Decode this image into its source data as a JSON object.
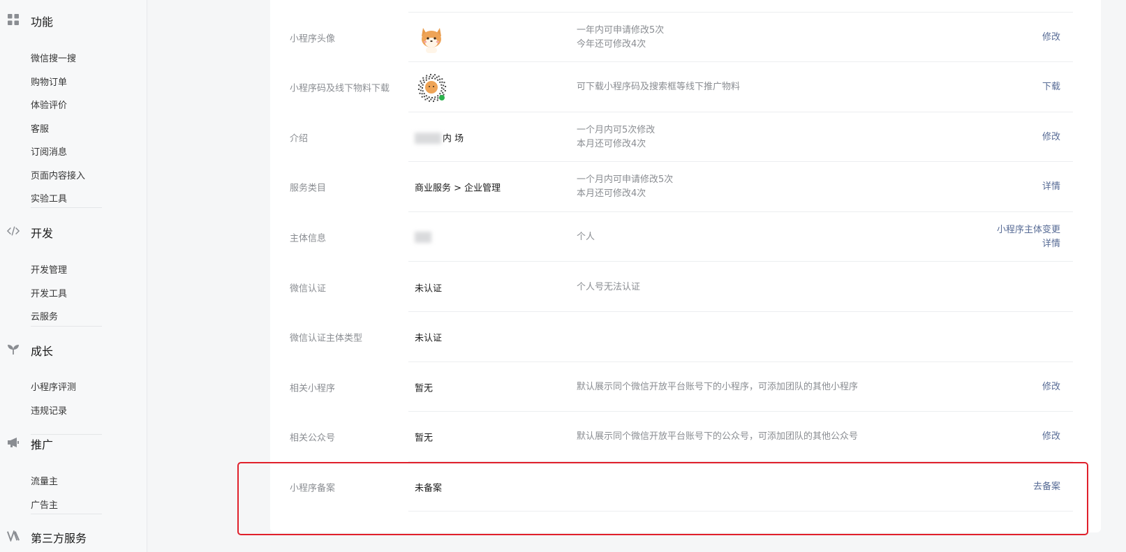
{
  "sidebar": {
    "groups": [
      {
        "icon": "grid-icon",
        "title": "功能",
        "items": [
          "微信搜一搜",
          "购物订单",
          "体验评价",
          "客服",
          "订阅消息",
          "页面内容接入",
          "实验工具"
        ]
      },
      {
        "icon": "code-icon",
        "title": "开发",
        "items": [
          "开发管理",
          "开发工具",
          "云服务"
        ]
      },
      {
        "icon": "sprout-icon",
        "title": "成长",
        "items": [
          "小程序评测",
          "违规记录"
        ]
      },
      {
        "icon": "megaphone-icon",
        "title": "推广",
        "items": [
          "流量主",
          "广告主"
        ]
      },
      {
        "icon": "third-party-icon",
        "title": "第三方服务",
        "items": []
      }
    ]
  },
  "settings": {
    "rows": [
      {
        "label": "小程序头像",
        "value_type": "avatar",
        "desc": [
          "一年内可申请修改5次",
          "今年还可修改4次"
        ],
        "actions": [
          "修改"
        ]
      },
      {
        "label": "小程序码及线下物料下载",
        "value_type": "qrcode",
        "desc": [
          "可下载小程序码及搜索框等线下推广物料"
        ],
        "actions": [
          "下载"
        ]
      },
      {
        "label": "介绍",
        "value_type": "blurred",
        "value": "内 场",
        "desc": [
          "一个月内可5次修改",
          "本月还可修改4次"
        ],
        "actions": [
          "修改"
        ]
      },
      {
        "label": "服务类目",
        "value": "商业服务 > 企业管理",
        "desc": [
          "一个月内可申请修改5次",
          "本月还可修改4次"
        ],
        "actions": [
          "详情"
        ]
      },
      {
        "label": "主体信息",
        "value_type": "blurred-small",
        "desc": [
          "个人"
        ],
        "actions": [
          "小程序主体变更",
          "详情"
        ]
      },
      {
        "label": "微信认证",
        "value": "未认证",
        "desc": [
          "个人号无法认证"
        ],
        "actions": []
      },
      {
        "label": "微信认证主体类型",
        "value": "未认证",
        "desc": [],
        "actions": []
      },
      {
        "label": "相关小程序",
        "value": "暂无",
        "desc": [
          "默认展示同个微信开放平台账号下的小程序，可添加团队的其他小程序"
        ],
        "actions": [
          "修改"
        ]
      },
      {
        "label": "相关公众号",
        "value": "暂无",
        "desc": [
          "默认展示同个微信开放平台账号下的公众号，可添加团队的其他公众号"
        ],
        "actions": [
          "修改"
        ]
      },
      {
        "label": "小程序备案",
        "value": "未备案",
        "desc": [],
        "actions": [
          "去备案"
        ],
        "highlighted": true
      }
    ]
  },
  "colors": {
    "link": "#576b95",
    "highlight_border": "#e0202b"
  }
}
